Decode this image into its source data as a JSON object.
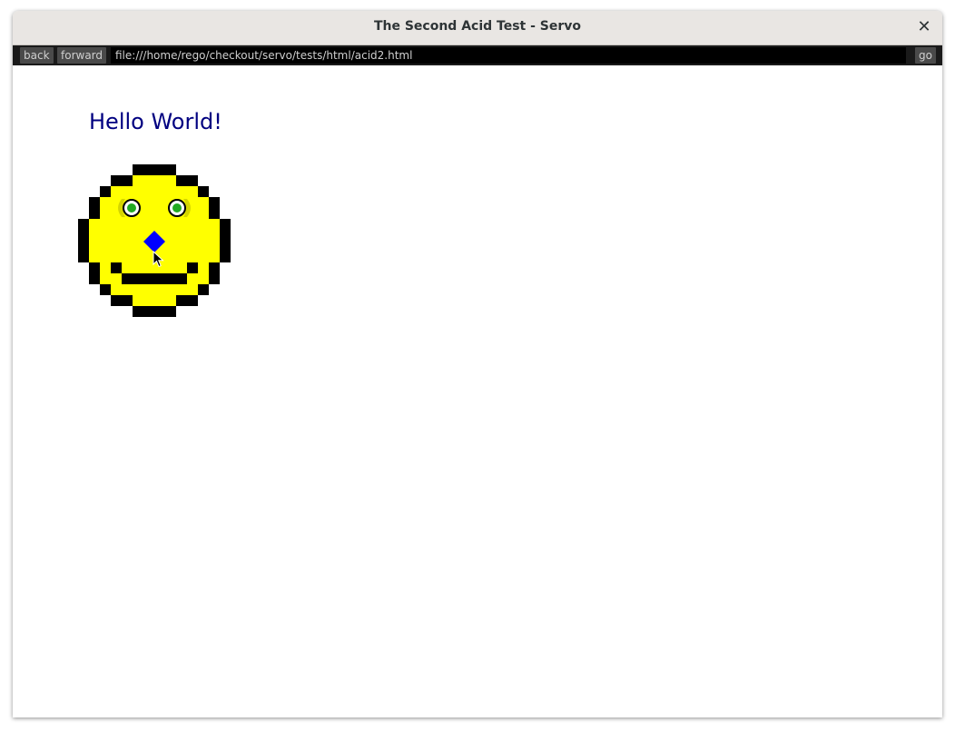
{
  "window": {
    "title": "The Second Acid Test - Servo",
    "close_symbol": "✕"
  },
  "navbar": {
    "back_label": "back",
    "forward_label": "forward",
    "url": "file:///home/rego/checkout/servo/tests/html/acid2.html",
    "go_label": "go"
  },
  "page": {
    "heading": "Hello World!",
    "heading_color": "#000080",
    "face_fill_color": "#ffff00",
    "face_outline_color": "#000000",
    "eye_color": "#22aa22",
    "nose_color": "#0000ff"
  }
}
